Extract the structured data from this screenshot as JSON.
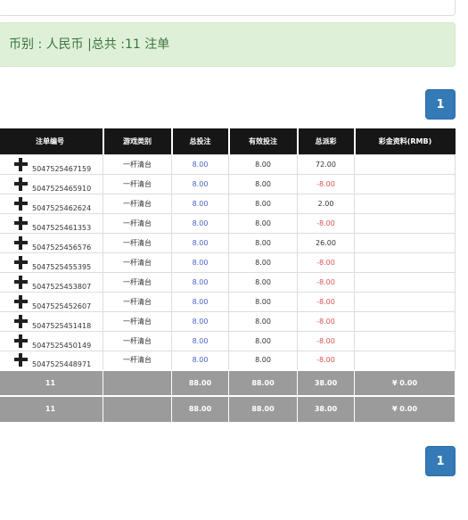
{
  "summary": {
    "text": "币别 : 人民币 |总共 :11 注单"
  },
  "pagination": {
    "current_page": "1"
  },
  "table": {
    "headers": [
      "注单编号",
      "游戏类别",
      "总投注",
      "有效投注",
      "总派彩",
      "彩金资料(RMB)"
    ],
    "rows": [
      {
        "id": "5047525467159",
        "game": "一杆清台",
        "total_bet": "8.00",
        "valid_bet": "8.00",
        "payout": "72.00",
        "payout_negative": false,
        "jackpot": ""
      },
      {
        "id": "5047525465910",
        "game": "一杆清台",
        "total_bet": "8.00",
        "valid_bet": "8.00",
        "payout": "-8.00",
        "payout_negative": true,
        "jackpot": ""
      },
      {
        "id": "5047525462624",
        "game": "一杆清台",
        "total_bet": "8.00",
        "valid_bet": "8.00",
        "payout": "2.00",
        "payout_negative": false,
        "jackpot": ""
      },
      {
        "id": "5047525461353",
        "game": "一杆清台",
        "total_bet": "8.00",
        "valid_bet": "8.00",
        "payout": "-8.00",
        "payout_negative": true,
        "jackpot": ""
      },
      {
        "id": "5047525456576",
        "game": "一杆清台",
        "total_bet": "8.00",
        "valid_bet": "8.00",
        "payout": "26.00",
        "payout_negative": false,
        "jackpot": ""
      },
      {
        "id": "5047525455395",
        "game": "一杆清台",
        "total_bet": "8.00",
        "valid_bet": "8.00",
        "payout": "-8.00",
        "payout_negative": true,
        "jackpot": ""
      },
      {
        "id": "5047525453807",
        "game": "一杆清台",
        "total_bet": "8.00",
        "valid_bet": "8.00",
        "payout": "-8.00",
        "payout_negative": true,
        "jackpot": ""
      },
      {
        "id": "5047525452607",
        "game": "一杆清台",
        "total_bet": "8.00",
        "valid_bet": "8.00",
        "payout": "-8.00",
        "payout_negative": true,
        "jackpot": ""
      },
      {
        "id": "5047525451418",
        "game": "一杆清台",
        "total_bet": "8.00",
        "valid_bet": "8.00",
        "payout": "-8.00",
        "payout_negative": true,
        "jackpot": ""
      },
      {
        "id": "5047525450149",
        "game": "一杆清台",
        "total_bet": "8.00",
        "valid_bet": "8.00",
        "payout": "-8.00",
        "payout_negative": true,
        "jackpot": ""
      },
      {
        "id": "5047525448971",
        "game": "一杆清台",
        "total_bet": "8.00",
        "valid_bet": "8.00",
        "payout": "-8.00",
        "payout_negative": true,
        "jackpot": ""
      }
    ],
    "totals": [
      {
        "count": "11",
        "game": "",
        "total_bet": "88.00",
        "valid_bet": "88.00",
        "payout": "38.00",
        "jackpot": "¥ 0.00"
      },
      {
        "count": "11",
        "game": "",
        "total_bet": "88.00",
        "valid_bet": "88.00",
        "payout": "38.00",
        "jackpot": "¥ 0.00"
      }
    ]
  },
  "colors": {
    "header_bg": "#161616",
    "total_bg": "#9b9b9b",
    "pager_bg": "#337ab7",
    "alert_bg": "#dff0d8",
    "alert_text": "#3c763d",
    "bet_blue": "#4a62c9",
    "loss_red": "#d9534f"
  },
  "icons": {
    "expand": "plus-icon"
  }
}
